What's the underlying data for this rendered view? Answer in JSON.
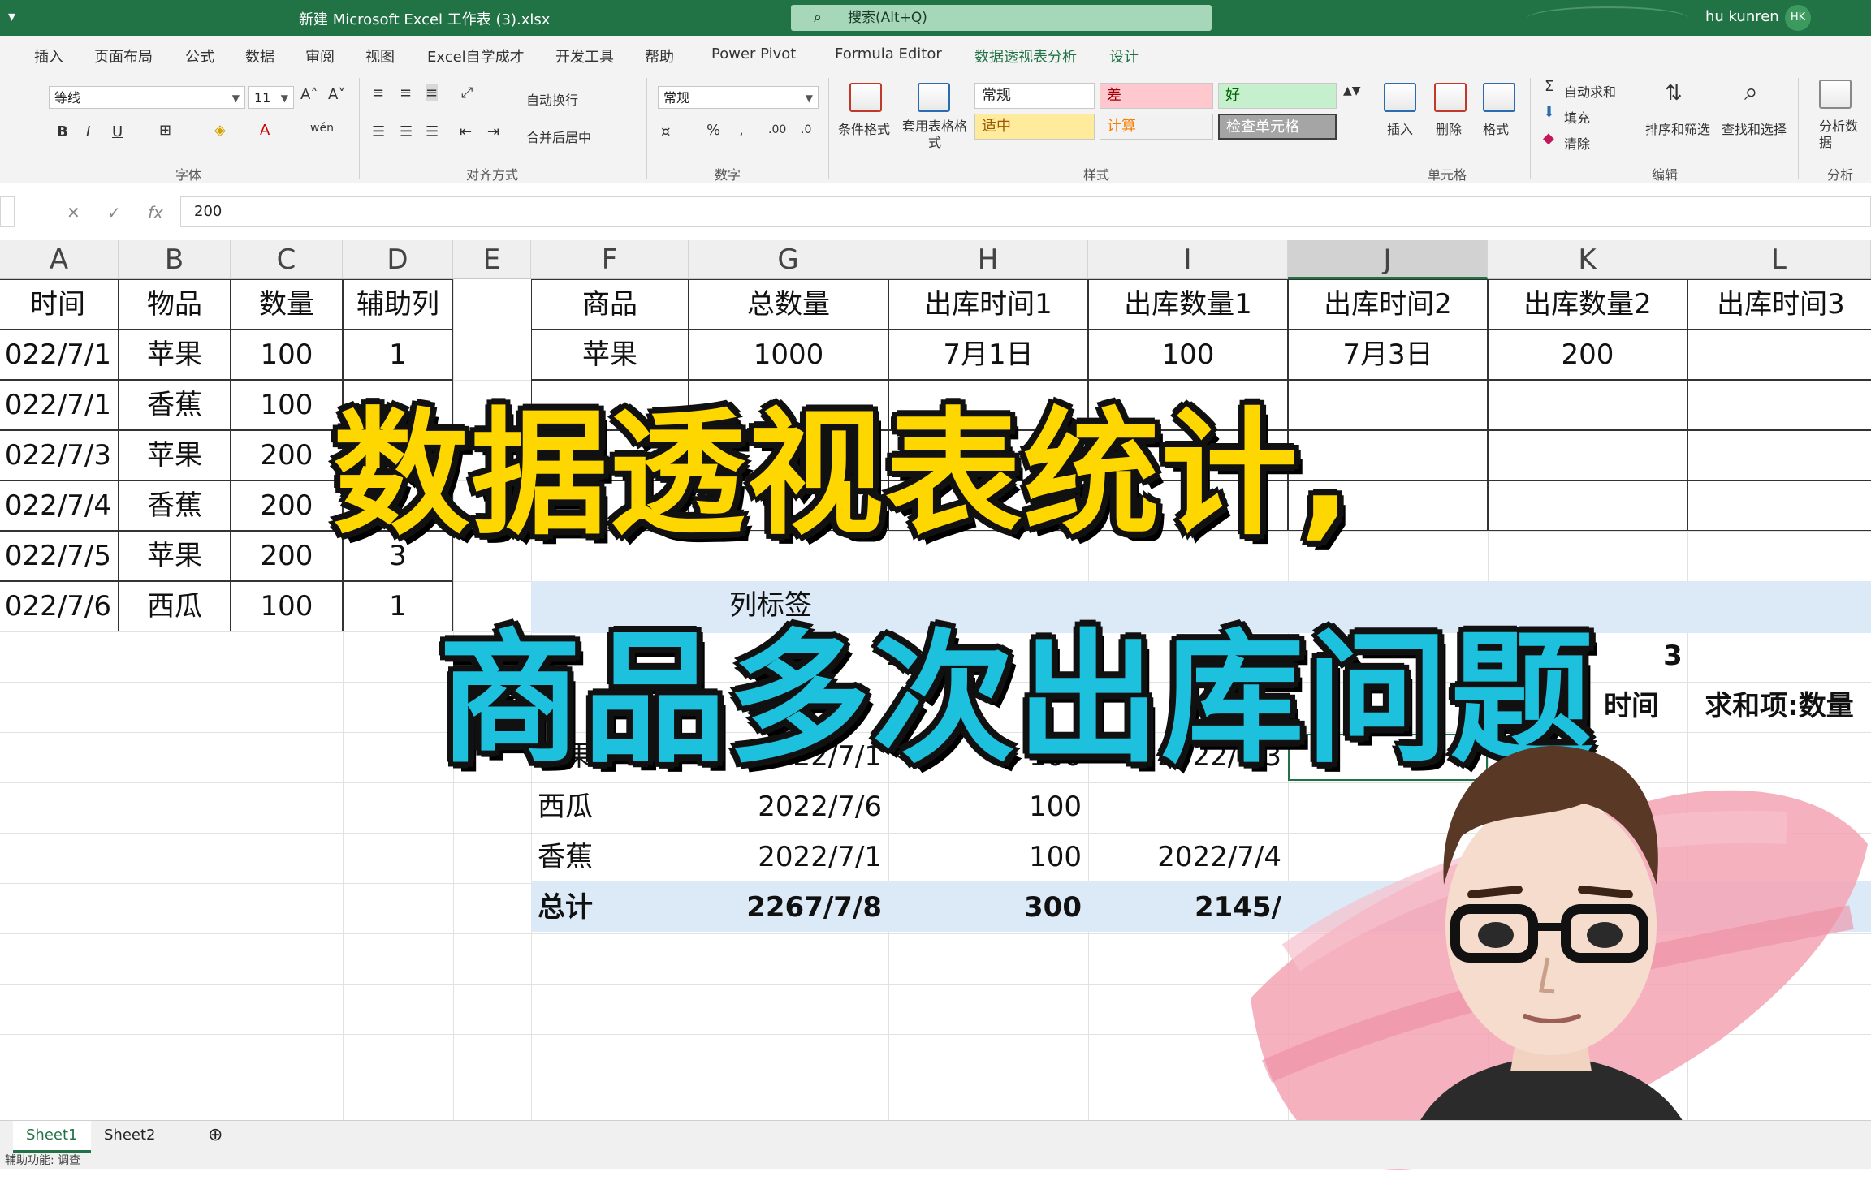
{
  "titlebar": {
    "doc_title": "新建 Microsoft Excel 工作表 (3).xlsx",
    "search_placeholder": "搜索(Alt+Q)",
    "user": "hu kunren",
    "user_initials": "HK"
  },
  "tabs": [
    "插入",
    "页面布局",
    "公式",
    "数据",
    "审阅",
    "视图",
    "Excel自学成才",
    "开发工具",
    "帮助",
    "Power Pivot",
    "Formula Editor",
    "数据透视表分析",
    "设计"
  ],
  "ribbon": {
    "font_name": "等线",
    "font_size": "11",
    "wrap_text": "自动换行",
    "merge_center": "合并后居中",
    "number_format": "常规",
    "cond_format": "条件格式",
    "table_format": "套用表格格式",
    "styles": {
      "normal": "常规",
      "bad": "差",
      "good": "好",
      "neutral": "适中",
      "calc": "计算",
      "check": "检查单元格"
    },
    "cells": {
      "insert": "插入",
      "delete": "删除",
      "format": "格式"
    },
    "editing": {
      "autosum": "自动求和",
      "fill": "填充",
      "clear": "清除",
      "sort": "排序和筛选",
      "find": "查找和选择"
    },
    "analysis": "分析数据",
    "groups": {
      "font": "字体",
      "align": "对齐方式",
      "number": "数字",
      "styles": "样式",
      "cells": "单元格",
      "editing": "编辑",
      "analysis": "分析"
    }
  },
  "formula": {
    "value": "200"
  },
  "columns": [
    "A",
    "B",
    "C",
    "D",
    "E",
    "F",
    "G",
    "H",
    "I",
    "J",
    "K",
    "L"
  ],
  "left_table": {
    "headers": [
      "时间",
      "物品",
      "数量",
      "辅助列"
    ],
    "rows": [
      [
        "022/7/1",
        "苹果",
        "100",
        "1"
      ],
      [
        "022/7/1",
        "香蕉",
        "100",
        ""
      ],
      [
        "022/7/3",
        "苹果",
        "200",
        ""
      ],
      [
        "022/7/4",
        "香蕉",
        "200",
        ""
      ],
      [
        "022/7/5",
        "苹果",
        "200",
        "3"
      ],
      [
        "022/7/6",
        "西瓜",
        "100",
        "1"
      ]
    ]
  },
  "right_table": {
    "headers": [
      "商品",
      "总数量",
      "出库时间1",
      "出库数量1",
      "出库时间2",
      "出库数量2",
      "出库时间3"
    ],
    "row1": [
      "苹果",
      "1000",
      "7月1日",
      "100",
      "7月3日",
      "200",
      ""
    ]
  },
  "pivot": {
    "col_label": "列标签",
    "col_nums": [
      "1",
      "3"
    ],
    "sub_headers": [
      "时间",
      "求和项:数量"
    ],
    "rows": [
      [
        "苹果",
        "2022/7/1",
        "100",
        "2022/7/3"
      ],
      [
        "西瓜",
        "2022/7/6",
        "100",
        ""
      ],
      [
        "香蕉",
        "2022/7/1",
        "100",
        "2022/7/4"
      ]
    ],
    "total": [
      "总计",
      "2267/7/8",
      "300",
      "2145/"
    ]
  },
  "overlay": {
    "line1": "数据透视表统计,",
    "line2": "商品多次出库问题"
  },
  "sheets": [
    "Sheet1",
    "Sheet2"
  ],
  "status": "辅助功能: 调查"
}
